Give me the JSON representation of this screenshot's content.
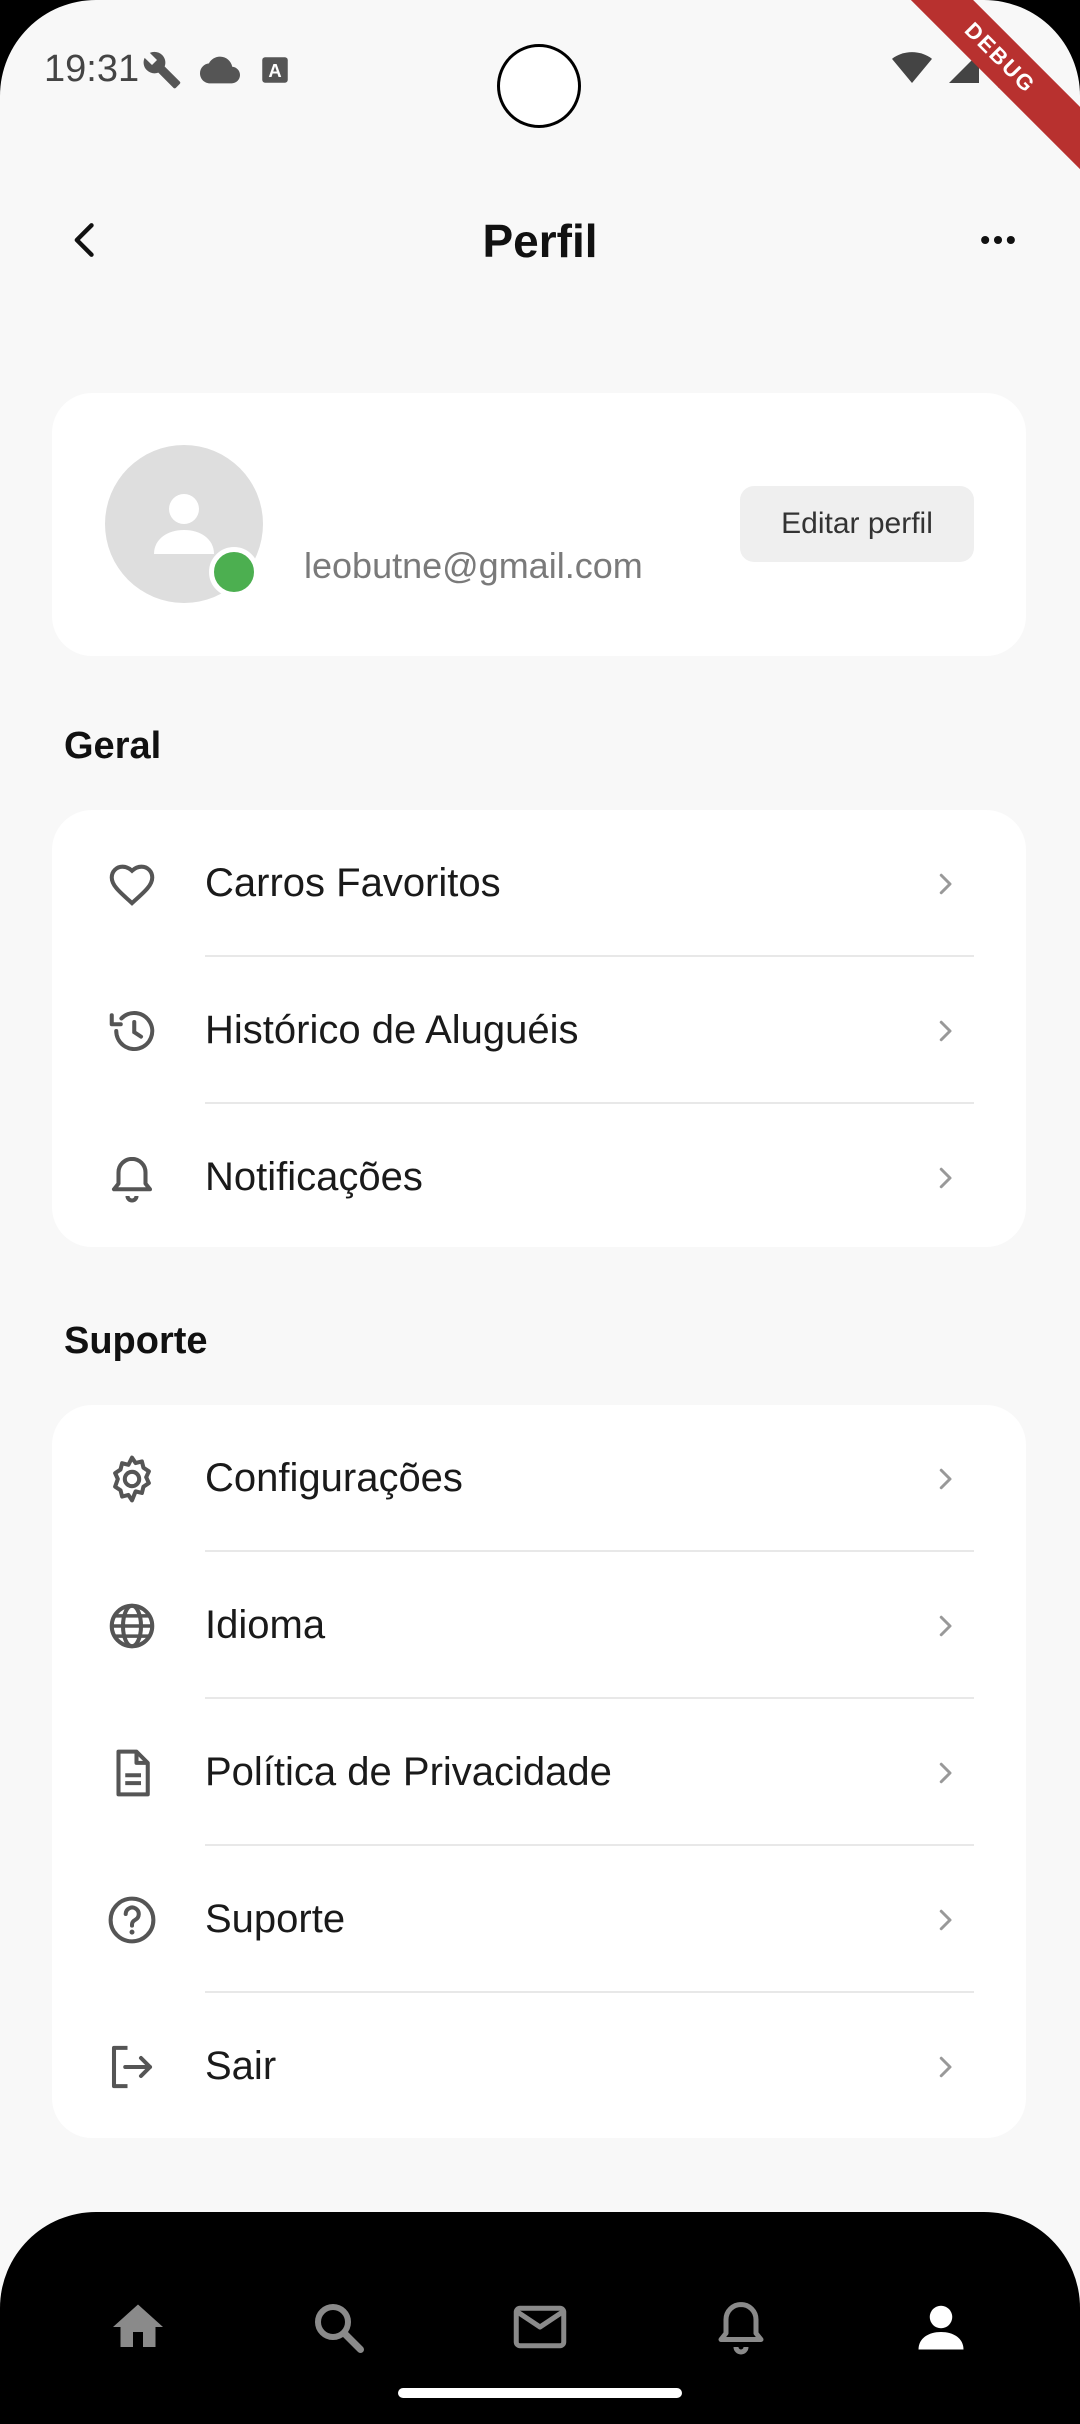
{
  "status_bar": {
    "time": "19:31",
    "debug_label": "DEBUG"
  },
  "app_bar": {
    "title": "Perfil"
  },
  "profile": {
    "email": "leobutne@gmail.com",
    "edit_label": "Editar perfil",
    "online_color": "#4caf50"
  },
  "sections": {
    "general_title": "Geral",
    "support_title": "Suporte"
  },
  "general_items": [
    {
      "label": "Carros Favoritos",
      "icon": "heart-icon"
    },
    {
      "label": "Histórico de Aluguéis",
      "icon": "history-icon"
    },
    {
      "label": "Notificações",
      "icon": "bell-icon"
    }
  ],
  "support_items": [
    {
      "label": "Configurações",
      "icon": "gear-icon"
    },
    {
      "label": "Idioma",
      "icon": "globe-icon"
    },
    {
      "label": "Política de Privacidade",
      "icon": "document-icon"
    },
    {
      "label": "Suporte",
      "icon": "help-icon"
    },
    {
      "label": "Sair",
      "icon": "logout-icon"
    }
  ],
  "bottom_nav": [
    "home-icon",
    "search-icon",
    "mail-icon",
    "bell-icon",
    "person-icon"
  ]
}
